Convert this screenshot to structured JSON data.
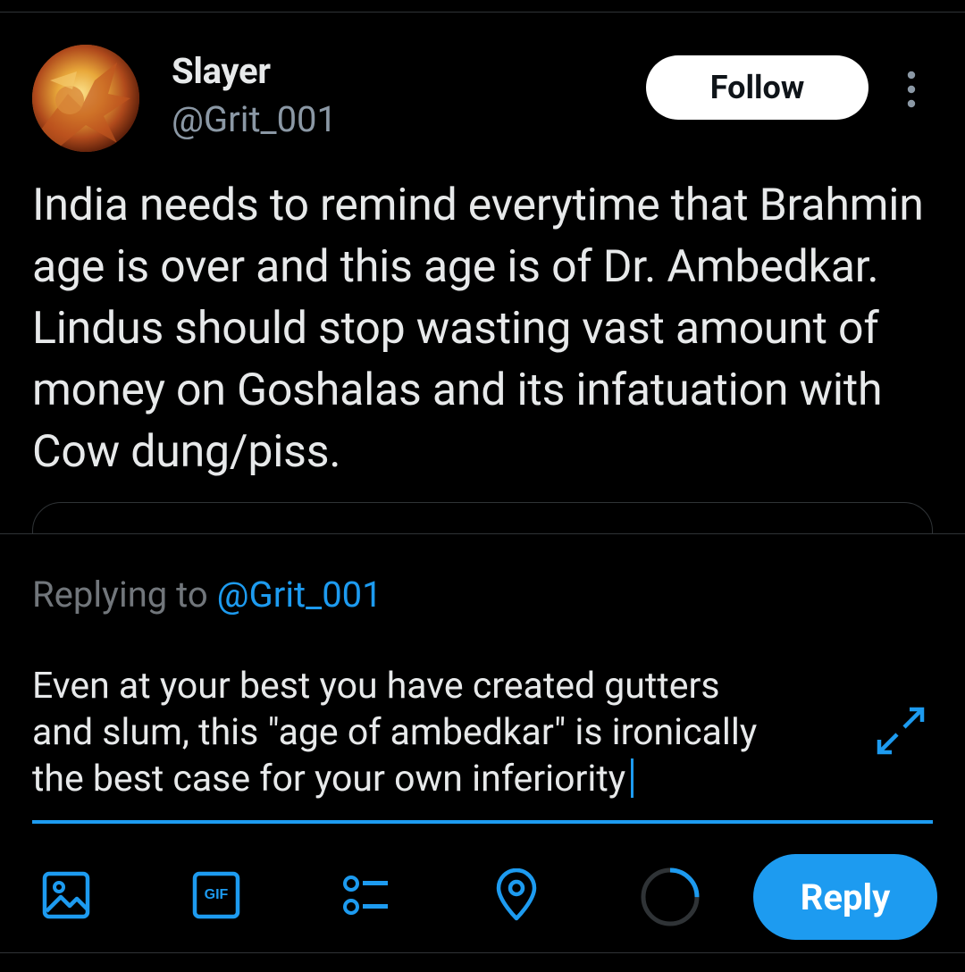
{
  "tweet": {
    "display_name": "Slayer",
    "handle": "@Grit_001",
    "follow_label": "Follow",
    "text": "India needs to remind everytime that Brahmin age is over and this age is of Dr. Ambedkar. Lindus should stop wasting vast amount of money on Goshalas and its infatuation with Cow dung/piss."
  },
  "compose": {
    "replying_prefix": "Replying to",
    "replying_handle": "@Grit_001",
    "reply_text": "Even at your best you have created gutters\nand slum, this \"age of ambedkar\" is ironically\nthe best case for your own inferiority",
    "reply_button_label": "Reply",
    "character_progress": 0.25
  },
  "toolbar": {
    "icons": [
      "image-icon",
      "gif-icon",
      "poll-icon",
      "location-icon"
    ],
    "gif_label": "GIF"
  },
  "colors": {
    "accent": "#1d9bf0",
    "background": "#000000",
    "text": "#e7e9ea",
    "muted": "#71767b"
  }
}
